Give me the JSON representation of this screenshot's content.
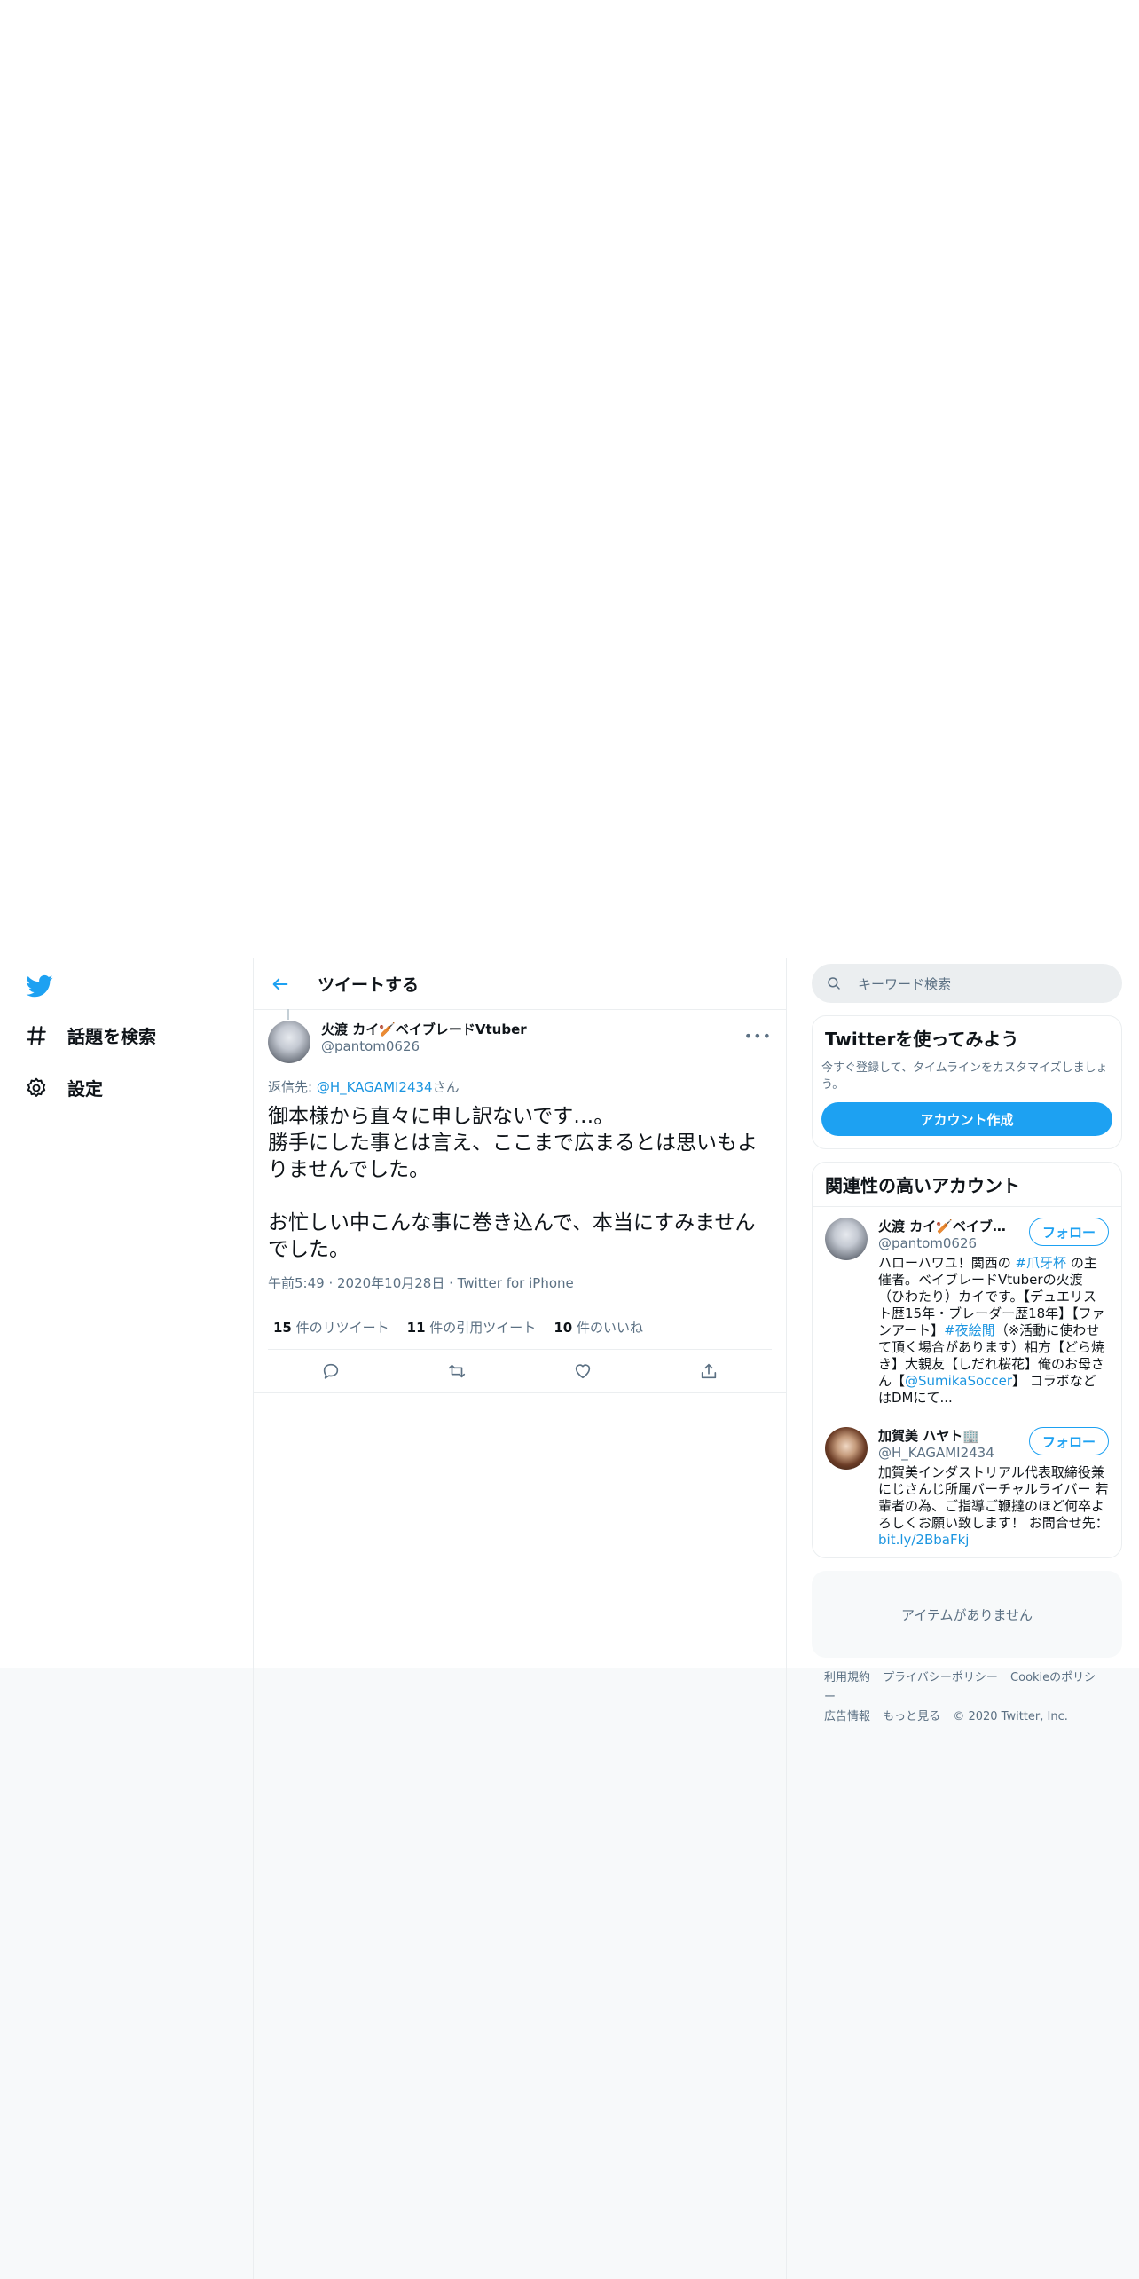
{
  "nav": {
    "explore_label": "話題を検索",
    "settings_label": "設定"
  },
  "header": {
    "title": "ツイートする"
  },
  "tweet": {
    "author_name": "火渡 カイ🏏ベイブレードVtuber",
    "author_handle": "@pantom0626",
    "reply_prefix": "返信先: ",
    "reply_handle": "@H_KAGAMI2434",
    "reply_suffix": "さん",
    "body": "御本様から直々に申し訳ないです…。\n勝手にした事とは言え、ここまで広まるとは思いもよりませんでした。\n\nお忙しい中こんな事に巻き込んで、本当にすみませんでした。",
    "time": "午前5:49",
    "date": "2020年10月28日",
    "source": "Twitter for iPhone",
    "stats": {
      "retweets_count": "15",
      "retweets_label": " 件のリツイート",
      "quotes_count": "11",
      "quotes_label": " 件の引用ツイート",
      "likes_count": "10",
      "likes_label": " 件のいいね"
    }
  },
  "search": {
    "placeholder": "キーワード検索"
  },
  "signup_card": {
    "title": "Twitterを使ってみよう",
    "subtitle": "今すぐ登録して、タイムラインをカスタマイズしましょう。",
    "button": "アカウント作成"
  },
  "related": {
    "title": "関連性の高いアカウント",
    "accounts": [
      {
        "name": "火渡 カイ🏏ベイブレ...",
        "handle": "@pantom0626",
        "follow": "フォロー",
        "bio_1": "ハローハワユ！関西の ",
        "bio_link_1": "#爪牙杯",
        "bio_2": " の主催者。ベイブレードVtuberの火渡（ひわたり）カイです。【デュエリスト歴15年・ブレーダー歴18年】【ファンアート】",
        "bio_link_2": "#夜絵閒",
        "bio_3": "（※活動に使わせて頂く場合があります）相方【どら焼き】大親友【しだれ桜花】俺のお母さん【",
        "bio_link_3": "@SumikaSoccer",
        "bio_4": "】 コラボなどはDMにて..."
      },
      {
        "name": "加賀美 ハヤト🏢",
        "handle": "@H_KAGAMI2434",
        "follow": "フォロー",
        "bio_1": "加賀美インダストリアル代表取締役兼 にじさんじ所属バーチャルライバー 若輩者の為、ご指導ご鞭撻のほど何卒よろしくお願い致します！ お問合せ先：",
        "bio_link_1": "bit.ly/2BbaFkj"
      }
    ]
  },
  "empty_trends": "アイテムがありません",
  "footer": {
    "terms": "利用規約",
    "privacy": "プライバシーポリシー",
    "cookie": "Cookieのポリシー",
    "ads": "広告情報",
    "more": "もっと見る",
    "copyright": "© 2020 Twitter, Inc."
  },
  "colors": {
    "accent": "#1da1f2",
    "link": "#1b95e0",
    "secondary_text": "#5b7083",
    "border": "#ebeef0"
  }
}
